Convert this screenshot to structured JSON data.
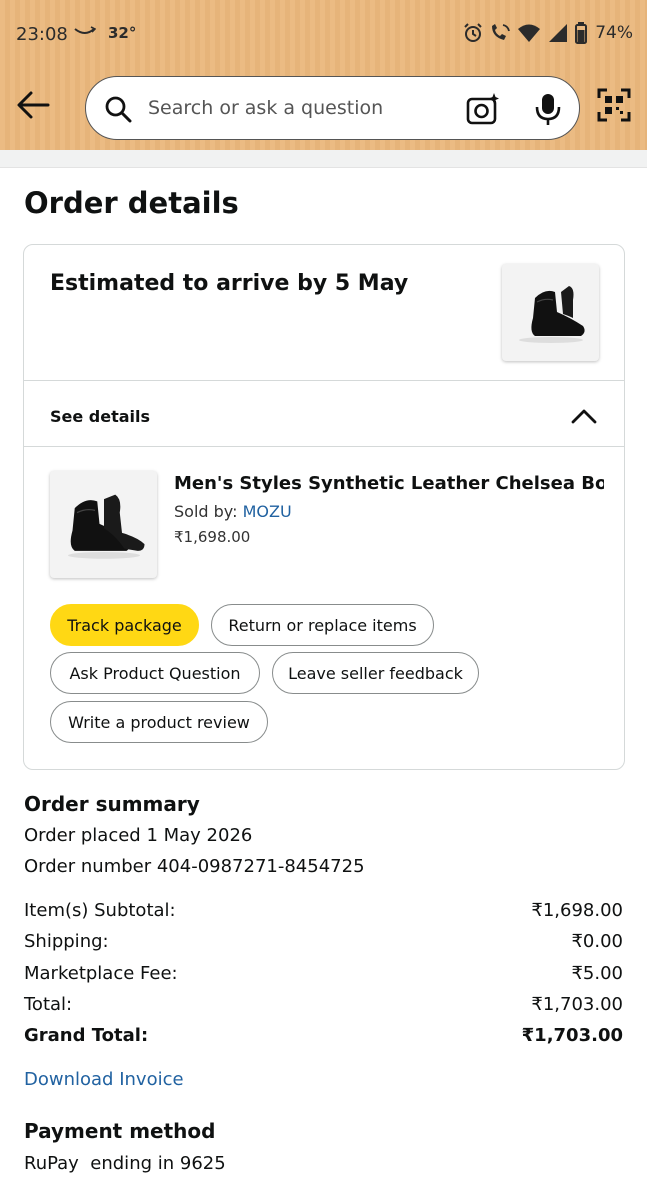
{
  "status": {
    "time": "23:08",
    "temperature": "32°",
    "battery": "74%",
    "icons": [
      "amazon-smile-icon",
      "alarm-icon",
      "call-icon",
      "wifi-icon",
      "signal-icon",
      "battery-icon"
    ]
  },
  "search": {
    "placeholder": "Search or ask a question"
  },
  "page": {
    "title": "Order details"
  },
  "shipment": {
    "arrival": "Estimated to arrive by 5 May",
    "see_details": "See details"
  },
  "product": {
    "title": "Men's Styles Synthetic Leather Chelsea Bo...",
    "sold_by_label": "Sold by: ",
    "seller": "MOZU",
    "price": "₹1,698.00"
  },
  "actions": {
    "track": "Track package",
    "return": "Return or replace items",
    "ask": "Ask Product Question",
    "feedback": "Leave seller feedback",
    "review": "Write a product review"
  },
  "summary": {
    "heading": "Order summary",
    "placed": "Order placed 1 May 2026",
    "number": "Order number 404-0987271-8454725",
    "rows": [
      {
        "label": "Item(s) Subtotal:",
        "value": "₹1,698.00"
      },
      {
        "label": "Shipping:",
        "value": "₹0.00"
      },
      {
        "label": "Marketplace Fee:",
        "value": "₹5.00"
      },
      {
        "label": "Total:",
        "value": "₹1,703.00"
      },
      {
        "label": "Grand Total:",
        "value": "₹1,703.00"
      }
    ],
    "invoice": "Download Invoice"
  },
  "payment": {
    "heading": "Payment method",
    "method": "RuPay  ending in 9625"
  },
  "colors": {
    "header_bg": "#ebbb83",
    "track_button": "#ffd814",
    "link": "#2162a1"
  }
}
